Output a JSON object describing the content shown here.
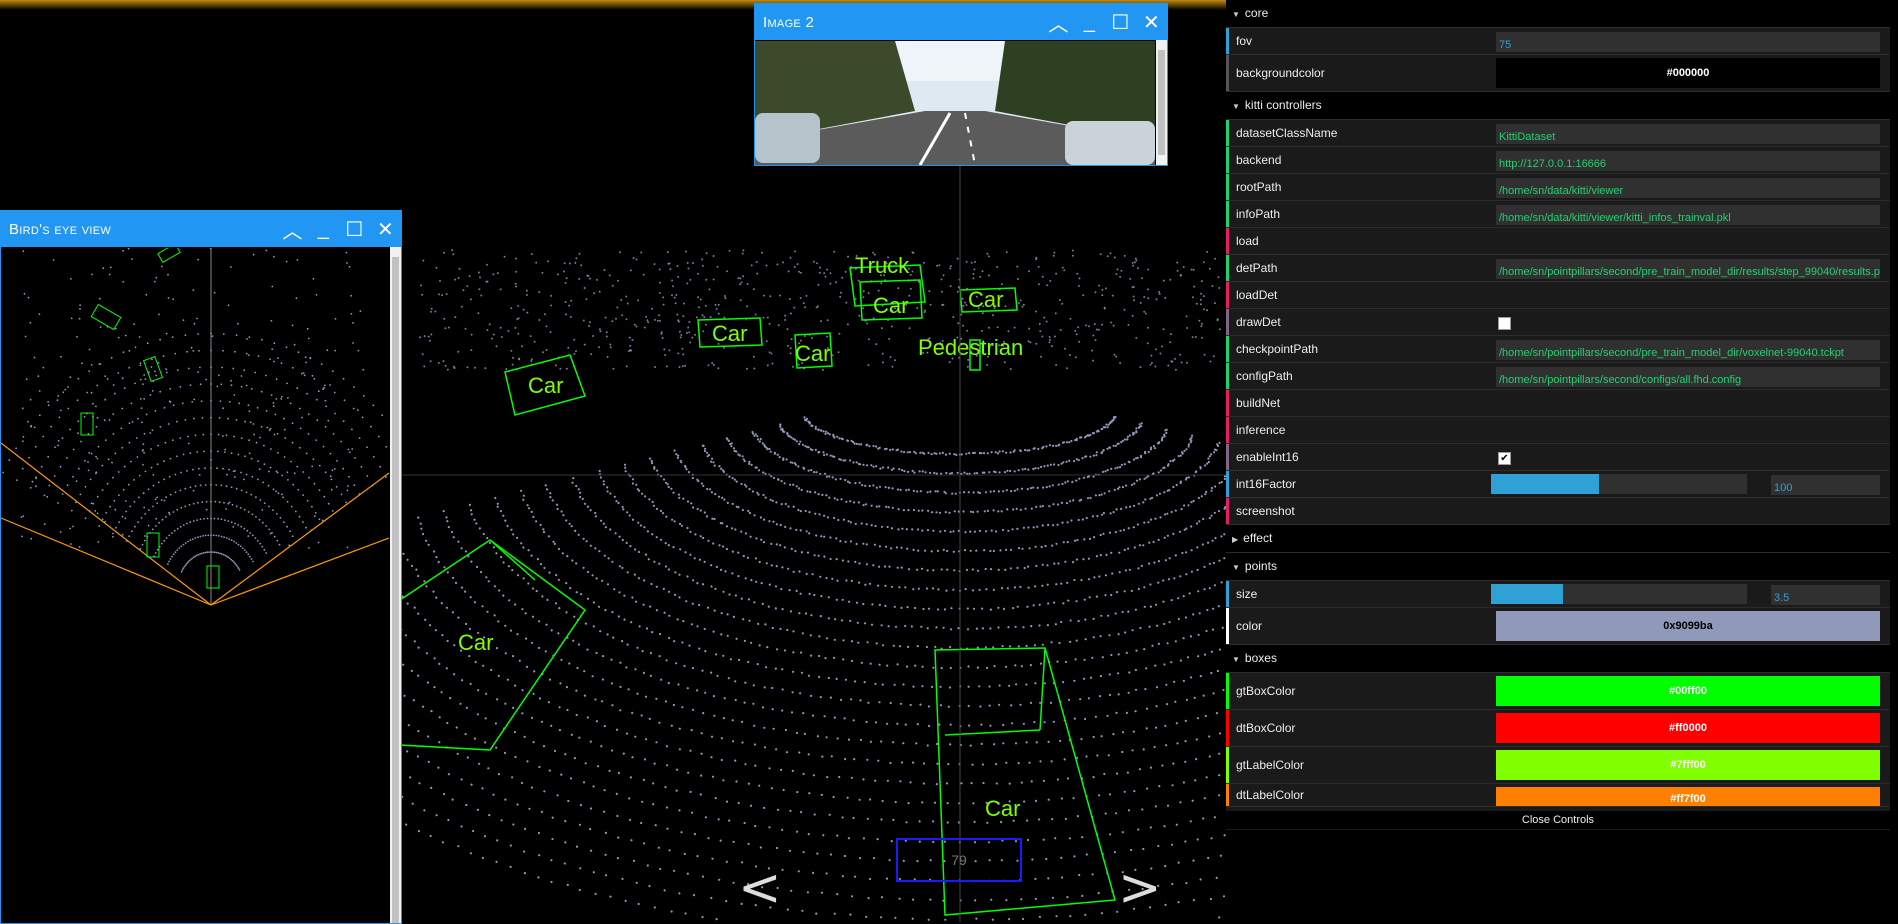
{
  "colors": {
    "accent": "#2196f3",
    "gt_box": "#00ff00",
    "dt_box": "#ff0000",
    "gt_label": "#7fff00",
    "dt_label": "#ff7f00",
    "points": "#9099ba",
    "fov_line": "#ff9900"
  },
  "scene": {
    "labels": [
      "Truck",
      "Car",
      "Car",
      "Car",
      "Car",
      "Car",
      "Car",
      "Pedestrian",
      "Car",
      "Car"
    ],
    "nav_prev": "<",
    "nav_next": ">",
    "index_value": "79"
  },
  "image_window": {
    "title": "Image 2"
  },
  "bev_window": {
    "title": "Bird's eye view"
  },
  "icons": {
    "minimize": "chevron-up-icon",
    "collapse": "minimize-icon",
    "maximize": "maximize-icon",
    "close": "close-icon"
  },
  "gui": {
    "core": {
      "folder": "core",
      "fov_label": "fov",
      "fov_value": "75",
      "background_label": "backgroundcolor",
      "background_value": "#000000"
    },
    "kitti": {
      "folder": "kitti controllers",
      "dataset_label": "datasetClassName",
      "dataset_value": "KittiDataset",
      "backend_label": "backend",
      "backend_value": "http://127.0.0.1:16666",
      "root_label": "rootPath",
      "root_value": "/home/sn/data/kitti/viewer",
      "info_label": "infoPath",
      "info_value": "/home/sn/data/kitti/viewer/kitti_infos_trainval.pkl",
      "load_label": "load",
      "det_label": "detPath",
      "det_value": "/home/sn/pointpillars/second/pre_train_model_dir/results/step_99040/results.pkl",
      "loaddet_label": "loadDet",
      "drawdet_label": "drawDet",
      "drawdet_checked": false,
      "ckpt_label": "checkpointPath",
      "ckpt_value": "/home/sn/pointpillars/second/pre_train_model_dir/voxelnet-99040.tckpt",
      "config_label": "configPath",
      "config_value": "/home/sn/pointpillars/second/configs/all.fhd.config",
      "buildnet_label": "buildNet",
      "inference_label": "inference",
      "int16_label": "enableInt16",
      "int16_checked": true,
      "factor_label": "int16Factor",
      "factor_value": "100",
      "factor_fraction": 0.42,
      "screenshot_label": "screenshot"
    },
    "effect": {
      "folder": "effect"
    },
    "points": {
      "folder": "points",
      "size_label": "size",
      "size_value": "3.5",
      "size_fraction": 0.28,
      "color_label": "color",
      "color_value": "0x9099ba"
    },
    "boxes": {
      "folder": "boxes",
      "gt_label": "gtBoxColor",
      "gt_value": "#00ff00",
      "dt_label": "dtBoxColor",
      "dt_value": "#ff0000",
      "gtl_label": "gtLabelColor",
      "gtl_value": "#7fff00",
      "dtl_label": "dtLabelColor",
      "dtl_value": "#ff7f00"
    },
    "close_label": "Close Controls"
  }
}
